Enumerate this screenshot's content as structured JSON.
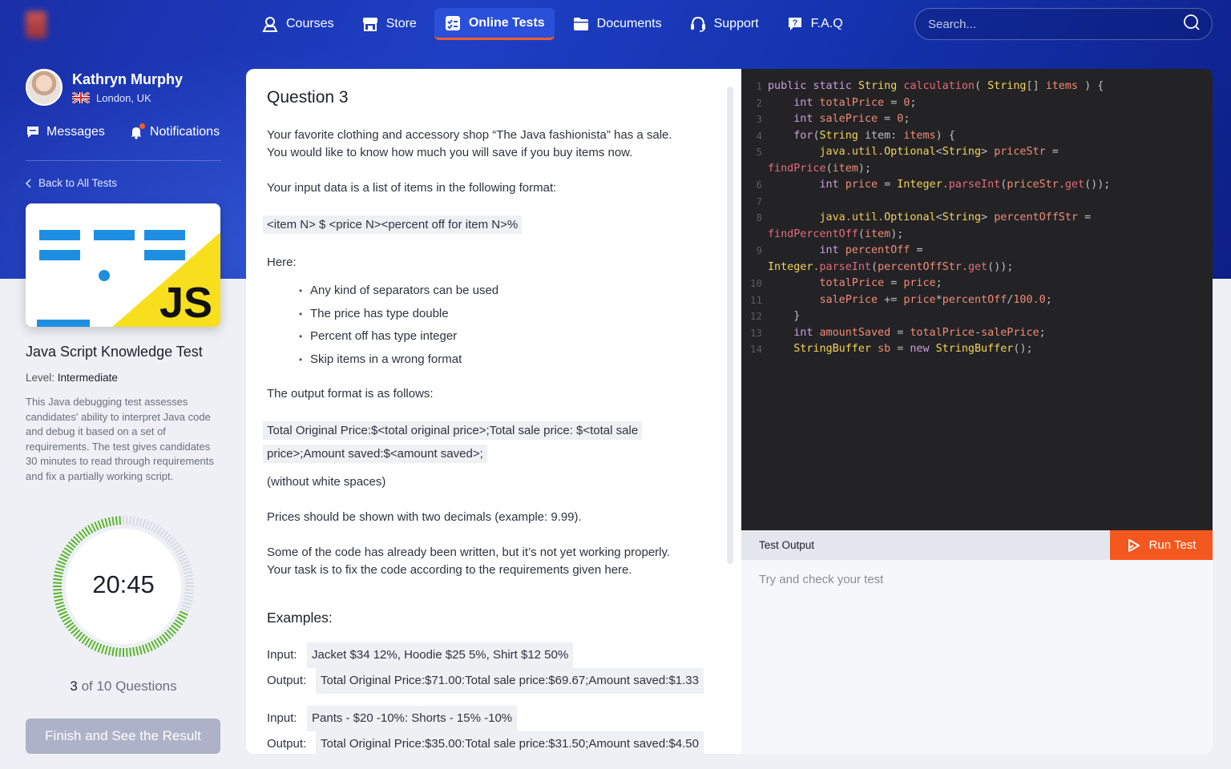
{
  "nav": {
    "items": [
      {
        "label": "Courses",
        "icon": "courses-icon",
        "active": false
      },
      {
        "label": "Store",
        "icon": "store-icon",
        "active": false
      },
      {
        "label": "Online Tests",
        "icon": "tests-icon",
        "active": true
      },
      {
        "label": "Documents",
        "icon": "folder-icon",
        "active": false
      },
      {
        "label": "Support",
        "icon": "headset-icon",
        "active": false
      },
      {
        "label": "F.A.Q",
        "icon": "faq-icon",
        "active": false
      }
    ],
    "search_placeholder": "Search..."
  },
  "profile": {
    "name": "Kathryn Murphy",
    "location": "London, UK",
    "messages_label": "Messages",
    "notifications_label": "Notifications"
  },
  "sidebar": {
    "back_label": "Back to All Tests",
    "test_title": "Java Script Knowledge Test",
    "level_label": "Level:",
    "level_value": "Intermediate",
    "description": "This Java debugging test assesses candidates' ability to interpret Java code and debug it based on a set of requirements. The test gives candidates 30 minutes to read through requirements and fix a partially working script.",
    "card_badge": "JS",
    "timer": "20:45",
    "timer_progress": 0.69,
    "question_current": "3",
    "question_total_text": "of 10 Questions",
    "finish_label": "Finish and See the Result"
  },
  "question": {
    "title": "Question 3",
    "intro_1": "Your favorite clothing and accessory shop “The Java fashionista” has a sale.",
    "intro_2": "You would like to know how much you will save if you buy items now.",
    "input_desc": "Your input data is a list of items in the following format:",
    "input_format": "<item N> $ <price N><percent off for item N>%",
    "here": "Here:",
    "bullets": [
      "Any kind of separators can be used",
      "The price has type double",
      "Percent off has type integer",
      "Skip items in a wrong format"
    ],
    "output_desc": "The output format is as follows:",
    "output_format_1": "Total Original Price:$<total original price>;Total sale price: $<total sale",
    "output_format_2": "price>;Amount saved:$<amount saved>;",
    "no_spaces": "(without white spaces)",
    "decimals": "Prices should be shown with two decimals (example: 9.99).",
    "task_1": "Some of the code has already been written, but it’s not yet working properly.",
    "task_2": "Your task is to fix the code according to the requirements given here.",
    "examples_title": "Examples:",
    "input_label": "Input:",
    "output_label": "Output:",
    "examples": [
      {
        "input": "Jacket $34 12%, Hoodie $25 5%, Shirt $12 50%",
        "output": "Total Original Price:$71.00:Total sale price:$69.67;Amount saved:$1.33"
      },
      {
        "input": "Pants - $20 -10%: Shorts - 15% -10%",
        "output": "Total Original Price:$35.00:Total sale price:$31.50;Amount saved:$4.50"
      }
    ]
  },
  "code": {
    "line_numbers": [
      "1",
      "2",
      "3",
      "4",
      "5",
      "",
      "6",
      "7",
      "8",
      "",
      "9",
      "",
      "10",
      "11",
      "12",
      "13",
      "14"
    ],
    "lines": [
      "public static String calculation( String[] items ) {",
      "    int totalPrice = 0;",
      "    int salePrice = 0;",
      "    for(String item: items) {",
      "        java.util.Optional<String> priceStr =",
      "findPrice(item);",
      "        int price = Integer.parseInt(priceStr.get());",
      "",
      "        java.util.Optional<String> percentOffStr =",
      "findPercentOff(item);",
      "        int percentOff =",
      "Integer.parseInt(percentOffStr.get());",
      "        totalPrice = price;",
      "        salePrice += price*percentOff/100.0;",
      "    }",
      "    int amountSaved = totalPrice-salePrice;",
      "    StringBuffer sb = new StringBuffer();"
    ]
  },
  "output": {
    "label": "Test Output",
    "run_label": "Run Test",
    "placeholder": "Try and check your test"
  },
  "colors": {
    "accent": "#f4581f",
    "primary": "#1e3fc4",
    "timer_green": "#5bb52a",
    "js_yellow": "#f7df1e",
    "code_bg": "#232326"
  }
}
